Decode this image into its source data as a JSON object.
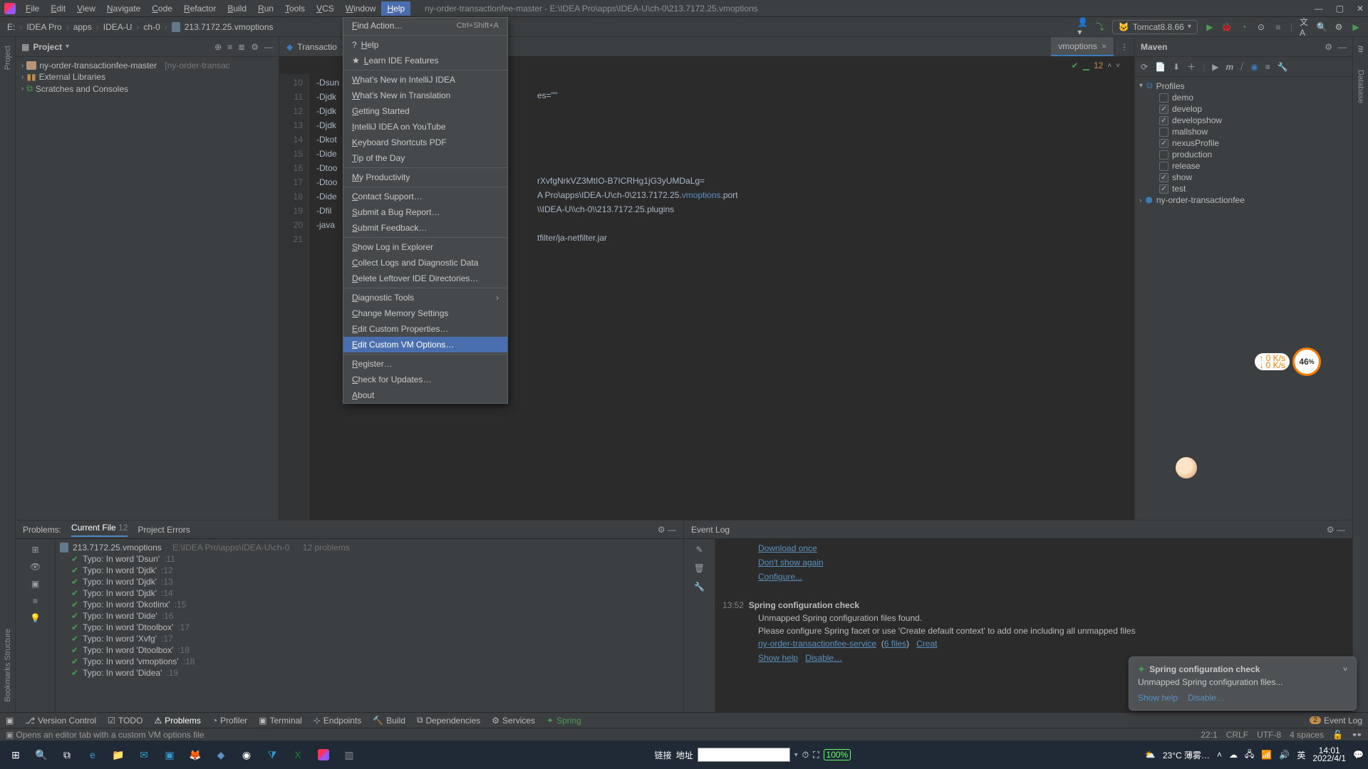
{
  "title": {
    "proj": "ny-order-transactionfee-master",
    "path": "E:\\IDEA Pro\\apps\\IDEA-U\\ch-0\\213.7172.25.vmoptions"
  },
  "menu": [
    "File",
    "Edit",
    "View",
    "Navigate",
    "Code",
    "Refactor",
    "Build",
    "Run",
    "Tools",
    "VCS",
    "Window",
    "Help"
  ],
  "menu_active": "Help",
  "breadcrumb": [
    "E:",
    "IDEA Pro",
    "apps",
    "IDEA-U",
    "ch-0",
    "213.7172.25.vmoptions"
  ],
  "run_config": "Tomcat8.8.66",
  "project": {
    "title": "Project",
    "root": {
      "name": "ny-order-transactionfee-master",
      "note": "[ny-order-transac"
    },
    "ext": "External Libraries",
    "scratch": "Scratches and Consoles"
  },
  "tabs": [
    {
      "label": "Transactio"
    },
    {
      "label": "vmoptions",
      "active": true
    }
  ],
  "inspection": {
    "count": "12"
  },
  "code": {
    "start": 10,
    "lines": [
      "-Dsun",
      "-Djdk",
      "-Djdk",
      "-Djdk",
      "-Dkot",
      "-Dide",
      "-Dtoo",
      "-Dtoo",
      "-Dide",
      "-Dfil",
      "-java",
      ""
    ],
    "frag1": "es=\"\"",
    "frag2": "rXvfgNrkVZ3MtIO-B7ICRHg1jG3yUMDaLg=",
    "frag3a": "A Pro\\apps\\IDEA-U\\ch-0\\213.7172.25.",
    "frag3b": "vmoptions",
    "frag3c": ".port",
    "frag4": "\\\\IDEA-U\\\\ch-0\\\\213.7172.25.plugins",
    "frag5": "tfilter/ja-netfilter.jar"
  },
  "maven": {
    "title": "Maven",
    "profiles": "Profiles",
    "items": [
      {
        "label": "demo",
        "on": false
      },
      {
        "label": "develop",
        "on": true
      },
      {
        "label": "developshow",
        "on": true
      },
      {
        "label": "mallshow",
        "on": false
      },
      {
        "label": "nexusProfile",
        "on": true
      },
      {
        "label": "production",
        "on": false
      },
      {
        "label": "release",
        "on": false
      },
      {
        "label": "show",
        "on": true
      },
      {
        "label": "test",
        "on": true
      }
    ],
    "mod": "ny-order-transactionfee"
  },
  "problems": {
    "head": "Problems:",
    "cur": "Current File",
    "cur_n": "12",
    "perr": "Project Errors",
    "file": "213.7172.25.vmoptions",
    "loc": "E:\\IDEA Pro\\apps\\IDEA-U\\ch-0",
    "lp": "12 problems",
    "items": [
      {
        "t": "Typo: In word 'Dsun'",
        "ln": ":11"
      },
      {
        "t": "Typo: In word 'Djdk'",
        "ln": ":12"
      },
      {
        "t": "Typo: In word 'Djdk'",
        "ln": ":13"
      },
      {
        "t": "Typo: In word 'Djdk'",
        "ln": ":14"
      },
      {
        "t": "Typo: In word 'Dkotlinx'",
        "ln": ":15"
      },
      {
        "t": "Typo: In word 'Dide'",
        "ln": ":16"
      },
      {
        "t": "Typo: In word 'Dtoolbox'",
        "ln": ":17"
      },
      {
        "t": "Typo: In word 'Xvfg'",
        "ln": ":17"
      },
      {
        "t": "Typo: In word 'Dtoolbox'",
        "ln": ":18"
      },
      {
        "t": "Typo: In word 'vmoptions'",
        "ln": ":18"
      },
      {
        "t": "Typo: In word 'Didea'",
        "ln": ":19"
      }
    ]
  },
  "event": {
    "title": "Event Log",
    "dl": "Download once",
    "ds": "Don't show again",
    "cf": "Configure...",
    "ts": "13:52",
    "sc": "Spring configuration check",
    "m1": "Unmapped Spring configuration files found.",
    "m2": "Please configure Spring facet or use 'Create default context' to add one including all unmapped files",
    "l1": "ny-order-transactionfee-service",
    "l1n": "6 files",
    "l2": "Creat",
    "sh": "Show help",
    "db": "Disable…"
  },
  "notif": {
    "t": "Spring configuration check",
    "m": "Unmapped Spring configuration files...",
    "a": "Show help",
    "b": "Disable…"
  },
  "toolstrip": [
    "Version Control",
    "TODO",
    "Problems",
    "Profiler",
    "Terminal",
    "Endpoints",
    "Build",
    "Dependencies",
    "Services",
    "Spring"
  ],
  "toolstrip_badge": "2",
  "toolstrip_ev": "Event Log",
  "status": {
    "hint": "Opens an editor tab with a custom VM options file",
    "pos": "22:1",
    "eol": "CRLF",
    "enc": "UTF-8",
    "ind": "4 spaces"
  },
  "help": [
    {
      "t": "Find Action…",
      "sc": "Ctrl+Shift+A"
    },
    "sep",
    {
      "t": "Help",
      "ic": "?"
    },
    {
      "t": "Learn IDE Features",
      "ic": "★"
    },
    "sep",
    {
      "t": "What's New in IntelliJ IDEA"
    },
    {
      "t": "What's New in Translation"
    },
    {
      "t": "Getting Started"
    },
    {
      "t": "IntelliJ IDEA on YouTube"
    },
    {
      "t": "Keyboard Shortcuts PDF"
    },
    {
      "t": "Tip of the Day"
    },
    "sep",
    {
      "t": "My Productivity"
    },
    "sep",
    {
      "t": "Contact Support…"
    },
    {
      "t": "Submit a Bug Report…"
    },
    {
      "t": "Submit Feedback…"
    },
    "sep",
    {
      "t": "Show Log in Explorer"
    },
    {
      "t": "Collect Logs and Diagnostic Data"
    },
    {
      "t": "Delete Leftover IDE Directories…"
    },
    "sep",
    {
      "t": "Diagnostic Tools",
      "sub": true
    },
    {
      "t": "Change Memory Settings"
    },
    {
      "t": "Edit Custom Properties…"
    },
    {
      "t": "Edit Custom VM Options…",
      "sel": true
    },
    "sep",
    {
      "t": "Register…"
    },
    {
      "t": "Check for Updates…"
    },
    {
      "t": "About"
    }
  ],
  "taskbar": {
    "mid_a": "链接",
    "mid_b": "地址",
    "weather": "23°C 薄雾…",
    "time": "14:01",
    "date": "2022/4/1",
    "zoom": "100%"
  },
  "speed": {
    "up": "↑ 0 K/s",
    "dn": "↓ 0 K/s",
    "val": "46"
  }
}
